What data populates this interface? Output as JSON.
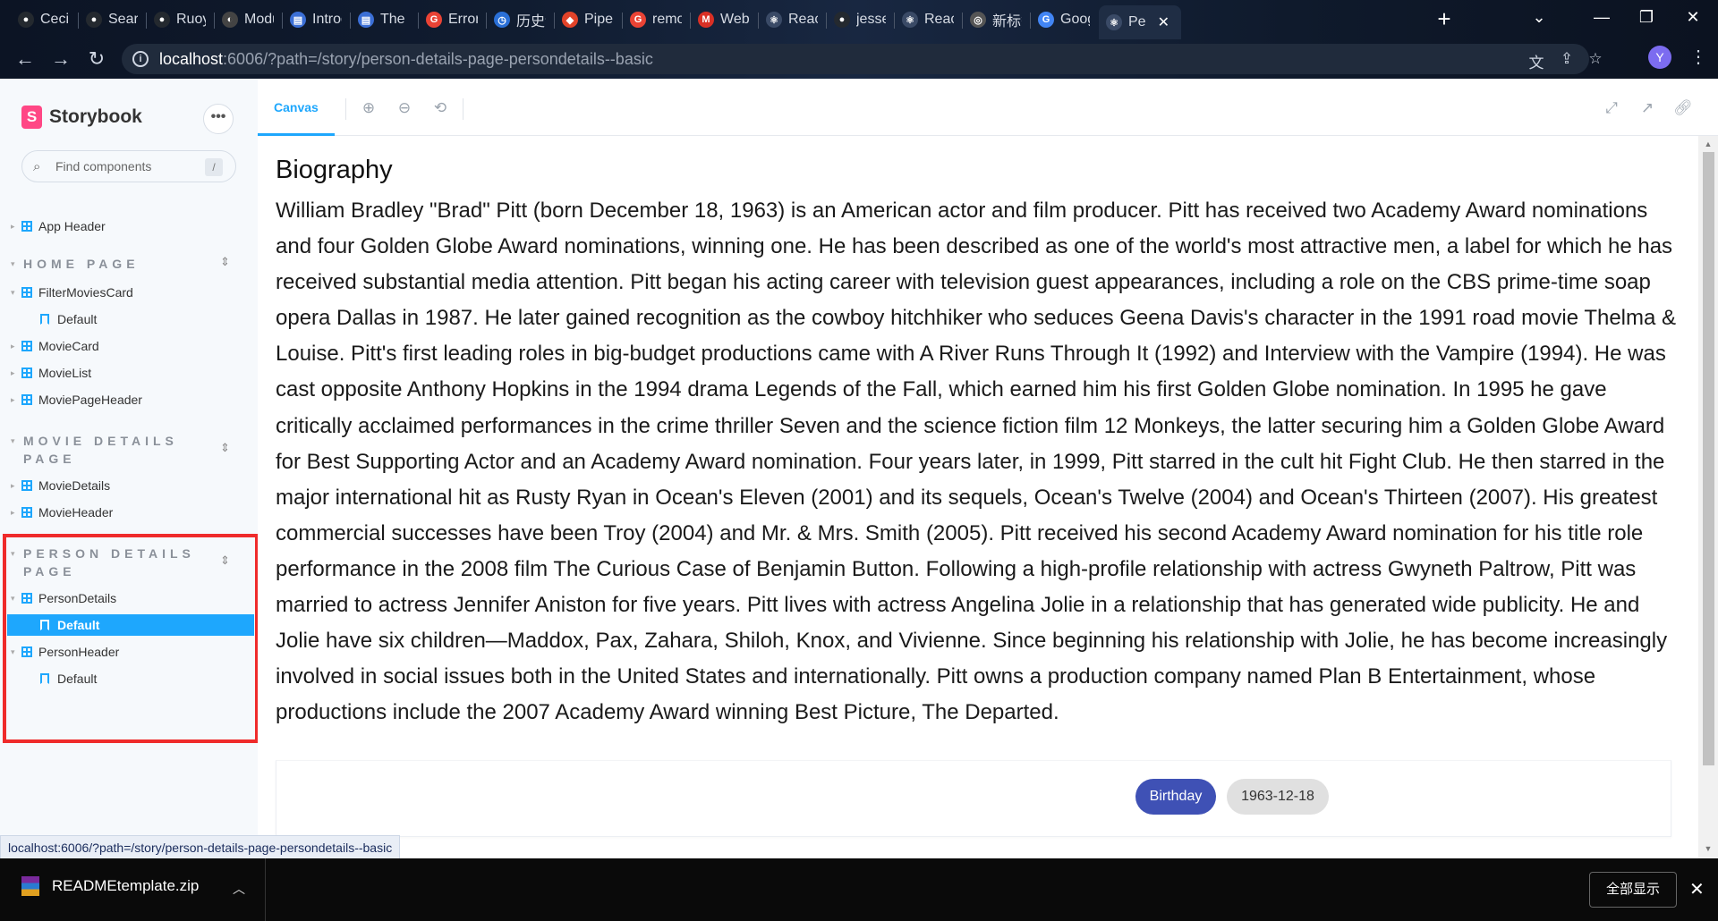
{
  "browser": {
    "tabs": [
      {
        "label": "Cecilia",
        "color": "#24292f",
        "glyph": "●"
      },
      {
        "label": "Search",
        "color": "#24292f",
        "glyph": "●"
      },
      {
        "label": "Ruoyi",
        "color": "#24292f",
        "glyph": "●"
      },
      {
        "label": "Modu",
        "color": "#444",
        "glyph": "◐"
      },
      {
        "label": "Introd",
        "color": "#3b6fd6",
        "glyph": "▤"
      },
      {
        "label": "The B",
        "color": "#3b6fd6",
        "glyph": "▤"
      },
      {
        "label": "Error",
        "color": "#ea4335",
        "glyph": "G"
      },
      {
        "label": "历史记",
        "color": "#2a6fd6",
        "glyph": "◷"
      },
      {
        "label": "Pipeli",
        "color": "#e24329",
        "glyph": "◆"
      },
      {
        "label": "remot",
        "color": "#ea4335",
        "glyph": "G"
      },
      {
        "label": "Web",
        "color": "#d93025",
        "glyph": "M"
      },
      {
        "label": "React",
        "color": "#3a4a66",
        "glyph": "⚛"
      },
      {
        "label": "jessej",
        "color": "#24292f",
        "glyph": "●"
      },
      {
        "label": "React",
        "color": "#3a4a66",
        "glyph": "⚛"
      },
      {
        "label": "新标签",
        "color": "#555",
        "glyph": "◎"
      },
      {
        "label": "Goog",
        "color": "#4285f4",
        "glyph": "G"
      },
      {
        "label": "Pe",
        "color": "#3a4a66",
        "glyph": "⚛",
        "active": true
      }
    ],
    "new_tab": "+",
    "url_host": "localhost",
    "url_rest": ":6006/?path=/story/person-details-page-persondetails--basic",
    "profile_initial": "Y"
  },
  "sidebar": {
    "brand": "Storybook",
    "more": "•••",
    "search_placeholder": "Find components",
    "search_shortcut": "/",
    "top_items": [
      {
        "label": "App Header"
      }
    ],
    "groups": [
      {
        "title": "HOME PAGE",
        "items": [
          {
            "type": "component",
            "label": "FilterMoviesCard",
            "expanded": true
          },
          {
            "type": "story",
            "label": "Default"
          },
          {
            "type": "component",
            "label": "MovieCard"
          },
          {
            "type": "component",
            "label": "MovieList"
          },
          {
            "type": "component",
            "label": "MoviePageHeader"
          }
        ]
      },
      {
        "title": "MOVIE DETAILS PAGE",
        "items": [
          {
            "type": "component",
            "label": "MovieDetails"
          },
          {
            "type": "component",
            "label": "MovieHeader"
          }
        ]
      },
      {
        "title": "PERSON DETAILS PAGE",
        "items": [
          {
            "type": "component",
            "label": "PersonDetails",
            "expanded": true
          },
          {
            "type": "story",
            "label": "Default",
            "selected": true
          },
          {
            "type": "component",
            "label": "PersonHeader",
            "expanded": true
          },
          {
            "type": "story",
            "label": "Default"
          }
        ]
      }
    ]
  },
  "preview": {
    "tab": "Canvas",
    "biography_title": "Biography",
    "biography_text": "William Bradley \"Brad\" Pitt (born December 18, 1963) is an American actor and film producer. Pitt has received two Academy Award nominations and four Golden Globe Award nominations, winning one. He has been described as one of the world's most attractive men, a label for which he has received substantial media attention. Pitt began his acting career with television guest appearances, including a role on the CBS prime-time soap opera Dallas in 1987. He later gained recognition as the cowboy hitchhiker who seduces Geena Davis's character in the 1991 road movie Thelma & Louise. Pitt's first leading roles in big-budget productions came with A River Runs Through It (1992) and Interview with the Vampire (1994). He was cast opposite Anthony Hopkins in the 1994 drama Legends of the Fall, which earned him his first Golden Globe nomination. In 1995 he gave critically acclaimed performances in the crime thriller Seven and the science fiction film 12 Monkeys, the latter securing him a Golden Globe Award for Best Supporting Actor and an Academy Award nomination. Four years later, in 1999, Pitt starred in the cult hit Fight Club. He then starred in the major international hit as Rusty Ryan in Ocean's Eleven (2001) and its sequels, Ocean's Twelve (2004) and Ocean's Thirteen (2007). His greatest commercial successes have been Troy (2004) and Mr. & Mrs. Smith (2005). Pitt received his second Academy Award nomination for his title role performance in the 2008 film The Curious Case of Benjamin Button. Following a high-profile relationship with actress Gwyneth Paltrow, Pitt was married to actress Jennifer Aniston for five years. Pitt lives with actress Angelina Jolie in a relationship that has generated wide publicity. He and Jolie have six children—Maddox, Pax, Zahara, Shiloh, Knox, and Vivienne. Since beginning his relationship with Jolie, he has become increasingly involved in social issues both in the United States and internationally. Pitt owns a production company named Plan B Entertainment, whose productions include the 2007 Academy Award winning Best Picture, The Departed.",
    "chip_label": "Birthday",
    "chip_value": "1963-12-18"
  },
  "status_url": "localhost:6006/?path=/story/person-details-page-persondetails--basic",
  "downloads": {
    "file_name": "READMEtemplate.zip",
    "show_all": "全部显示"
  },
  "colors": {
    "accent": "#1ea7fd",
    "storybook_pink": "#ff4785",
    "chip_primary": "#3f51b5",
    "highlight": "#ef2b2b"
  }
}
